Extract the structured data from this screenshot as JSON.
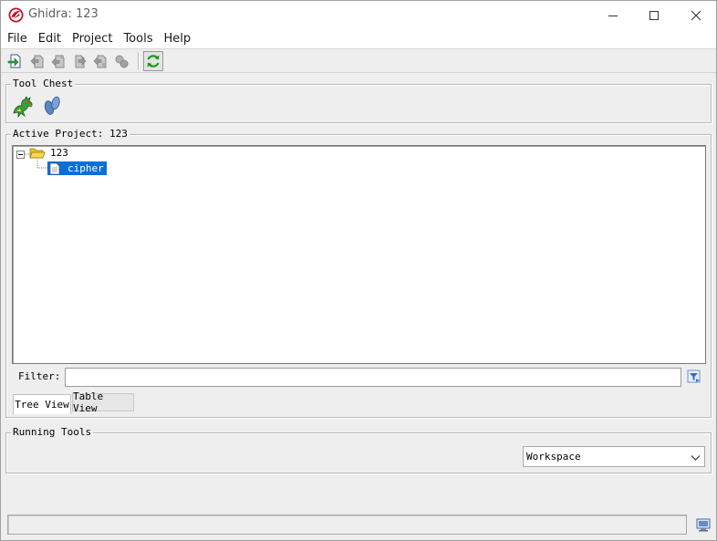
{
  "window": {
    "title": "Ghidra: 123",
    "controls": [
      "minimize-icon",
      "maximize-icon",
      "close-icon"
    ]
  },
  "menubar": {
    "items": [
      {
        "label": "File"
      },
      {
        "label": "Edit"
      },
      {
        "label": "Project"
      },
      {
        "label": "Tools"
      },
      {
        "label": "Help"
      }
    ]
  },
  "toolbar": {
    "buttons": [
      "import-file-icon",
      "checkin-icon",
      "checkout-icon",
      "update-icon",
      "undo-checkout-icon",
      "find-checkouts-icon",
      "refresh-icon"
    ]
  },
  "tool_chest": {
    "title": "Tool Chest",
    "tools": [
      "code-browser-dragon-icon",
      "version-tracking-footprints-icon"
    ]
  },
  "active_project": {
    "title": "Active Project: 123",
    "tree": {
      "root": "123",
      "children": [
        {
          "label": "cipher",
          "selected": true
        }
      ]
    },
    "filter": {
      "label": "Filter:",
      "value": ""
    },
    "tabs": [
      {
        "label": "Tree View",
        "active": true
      },
      {
        "label": "Table View",
        "active": false
      }
    ]
  },
  "running_tools": {
    "title": "Running Tools",
    "workspace_selected": "Workspace"
  },
  "statusbar": {
    "text": ""
  },
  "colors": {
    "selection": "#0a6fd6",
    "ghidra_red": "#c8102e",
    "refresh_green": "#1a9a1a"
  }
}
